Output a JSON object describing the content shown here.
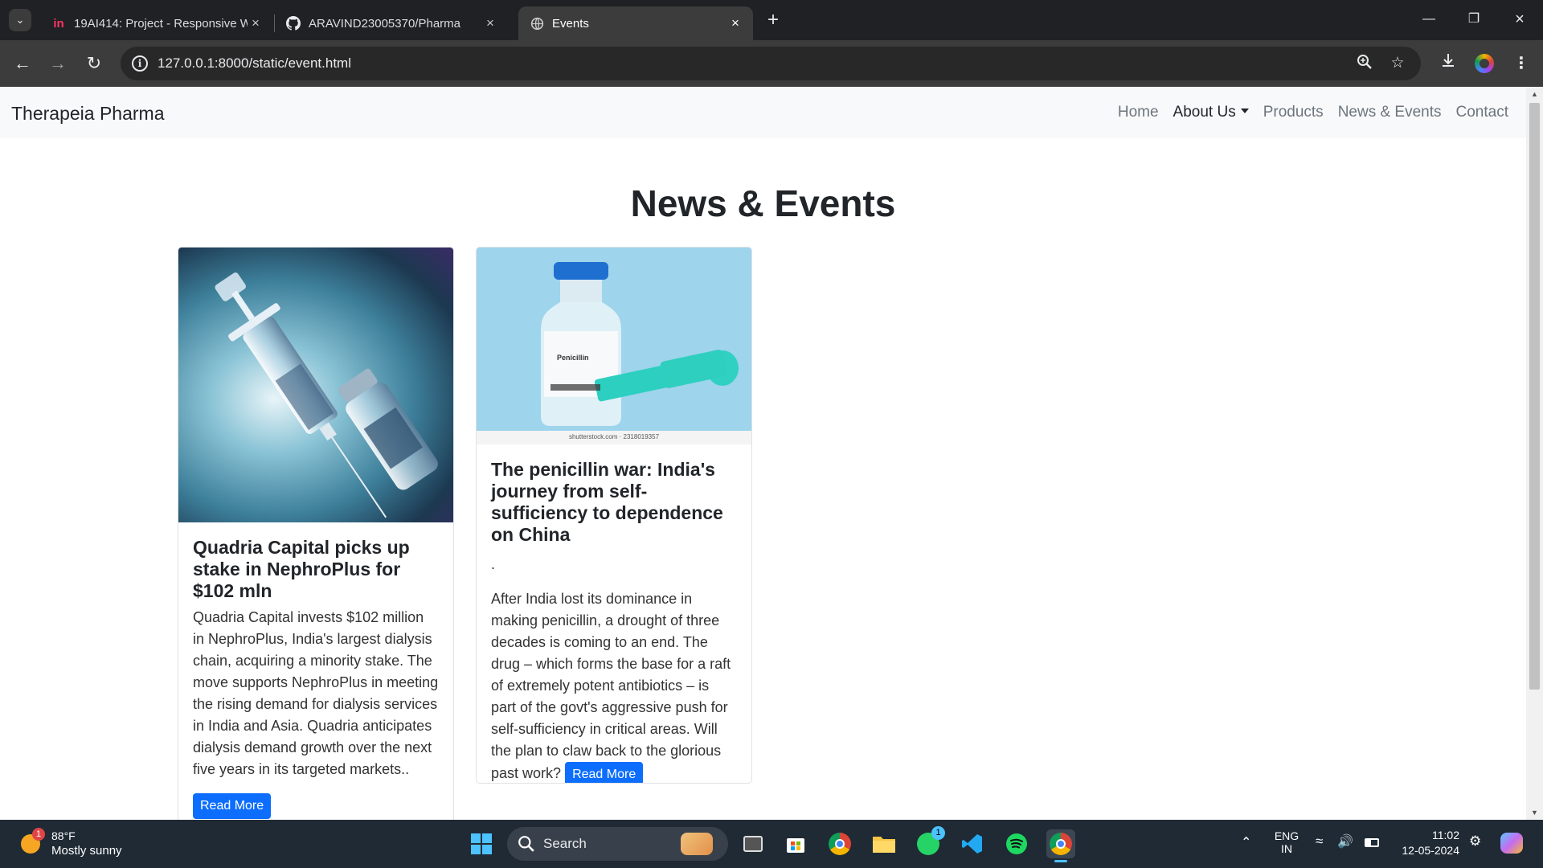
{
  "browser": {
    "tabs": [
      {
        "title": "19AI414: Project - Responsive W",
        "icon": "invision-icon",
        "active": false
      },
      {
        "title": "ARAVIND23005370/Pharma",
        "icon": "github-icon",
        "active": false
      },
      {
        "title": "Events",
        "icon": "globe-icon",
        "active": true
      }
    ],
    "url": "127.0.0.1:8000/static/event.html"
  },
  "navbar": {
    "brand": "Therapeia Pharma",
    "links": {
      "home": "Home",
      "about": "About Us",
      "products": "Products",
      "news": "News & Events",
      "contact": "Contact"
    }
  },
  "page": {
    "heading": "News & Events",
    "cards": [
      {
        "title": "Quadria Capital picks up stake in NephroPlus for $102 mln",
        "text": "Quadria Capital invests $102 million in NephroPlus, India's largest dialysis chain, acquiring a minority stake. The move supports NephroPlus in meeting the rising demand for dialysis services in India and Asia. Quadria anticipates dialysis demand growth over the next five years in its targeted markets..",
        "button": "Read More",
        "image": "syringe-and-vial-image"
      },
      {
        "title": "The penicillin war: India's journey from self-sufficiency to dependence on China",
        "dot": ".",
        "text": "After India lost its dominance in making penicillin, a drought of three decades is coming to an end. The drug – which forms the base for a raft of extremely potent antibiotics – is part of the govt's aggressive push for self-sufficiency in critical areas. Will the plan to claw back to the glorious past work?",
        "button": "Read More",
        "image": "penicillin-vial-image",
        "image_label": "Penicillin",
        "image_caption": "shutterstock.com · 2318019357"
      }
    ]
  },
  "taskbar": {
    "weather": {
      "temp": "88°F",
      "desc": "Mostly sunny",
      "badge": "1"
    },
    "search_placeholder": "Search",
    "whatsapp_badge": "1",
    "lang_top": "ENG",
    "lang_bottom": "IN",
    "time": "11:02",
    "date": "12-05-2024"
  }
}
